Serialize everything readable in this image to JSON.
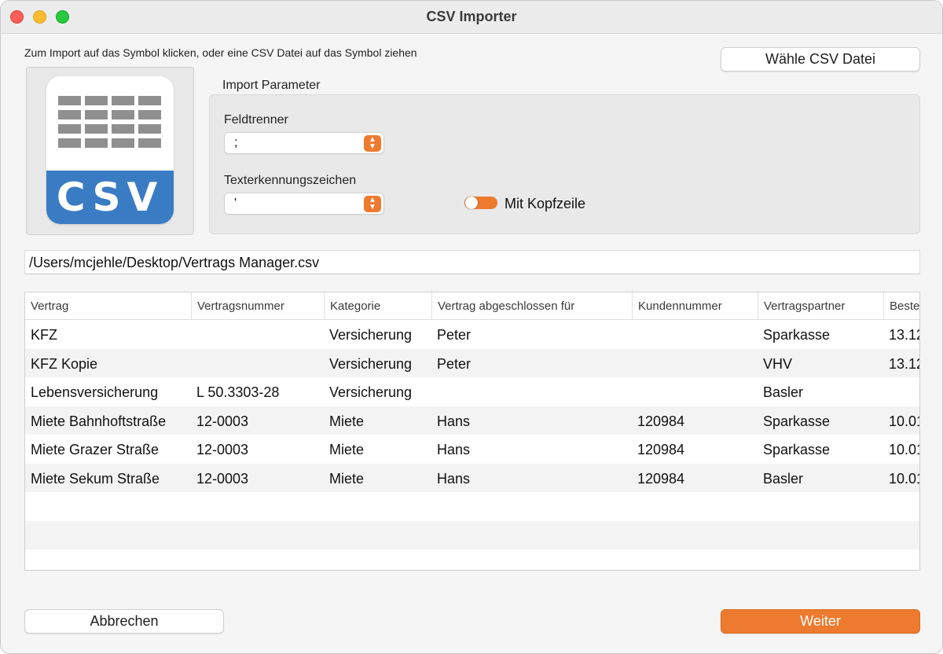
{
  "window": {
    "title": "CSV Importer"
  },
  "hint": "Zum Import auf das Symbol klicken, oder eine CSV Datei auf das Symbol ziehen",
  "buttons": {
    "choose": "Wähle CSV Datei",
    "cancel": "Abbrechen",
    "next": "Weiter"
  },
  "icon": {
    "band_text": "CSV",
    "name": "csv-file-icon"
  },
  "params": {
    "label": "Import Parameter",
    "separator_label": "Feldtrenner",
    "separator_value": ";",
    "text_qualifier_label": "Texterkennungszeichen",
    "text_qualifier_value": "'",
    "header_toggle_label": "Mit Kopfzeile",
    "header_toggle_on": false
  },
  "file_path": "/Users/mcjehle/Desktop/Vertrags Manager.csv",
  "table": {
    "columns": [
      "Vertrag",
      "Vertragsnummer",
      "Kategorie",
      "Vertrag abgeschlossen für",
      "Kundennummer",
      "Vertragspartner",
      "Beste"
    ],
    "rows": [
      [
        "KFZ",
        "",
        "Versicherung",
        "Peter",
        "",
        "Sparkasse",
        "13.12"
      ],
      [
        "KFZ Kopie",
        "",
        "Versicherung",
        "Peter",
        "",
        "VHV",
        "13.12"
      ],
      [
        "Lebensversicherung",
        "L 50.3303-28",
        "Versicherung",
        "",
        "",
        "Basler",
        ""
      ],
      [
        "Miete Bahnhoftstraße",
        "12-0003",
        "Miete",
        "Hans",
        "120984",
        "Sparkasse",
        "10.01"
      ],
      [
        "Miete Grazer Straße",
        "12-0003",
        "Miete",
        "Hans",
        "120984",
        "Sparkasse",
        "10.01"
      ],
      [
        "Miete Sekum Straße",
        "12-0003",
        "Miete",
        "Hans",
        "120984",
        "Basler",
        "10.01"
      ]
    ]
  },
  "colors": {
    "accent": "#ed7a2e",
    "csv_band": "#3a7cc3"
  }
}
